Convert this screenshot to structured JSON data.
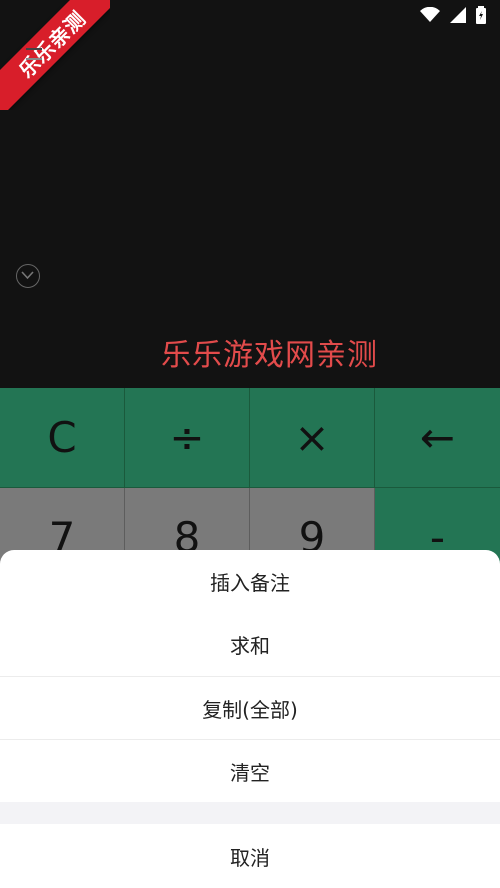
{
  "watermark": {
    "text": "乐乐亲测"
  },
  "display": {
    "overlay_text": "乐乐游戏网亲测"
  },
  "keypad": {
    "row1": [
      "C",
      "÷",
      "×",
      "←"
    ],
    "row2": [
      "7",
      "8",
      "9",
      "-"
    ]
  },
  "action_sheet": {
    "items": [
      "插入备注",
      "求和",
      "复制(全部)",
      "清空"
    ],
    "cancel": "取消"
  }
}
